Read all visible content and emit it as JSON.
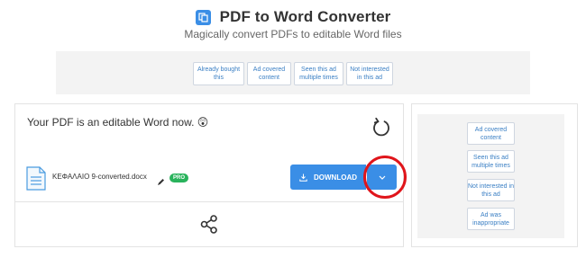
{
  "header": {
    "title": "PDF to Word Converter",
    "subtitle": "Magically convert PDFs to editable Word files",
    "icon": "document-convert-icon"
  },
  "top_ad_feedback": [
    "Already bought this",
    "Ad covered content",
    "Seen this ad multiple times",
    "Not interested in this ad"
  ],
  "result": {
    "status": "Your PDF is an editable Word now. 😲",
    "file_name": "ΚΕΦΑΛΑΙΟ 9-converted.docx",
    "pro_badge": "PRO",
    "download_label": "DOWNLOAD"
  },
  "side_ad_feedback": [
    "Ad covered content",
    "Seen this ad multiple times",
    "Not interested in this ad",
    "Ad was inappropriate"
  ],
  "colors": {
    "accent": "#3a8ee6",
    "pro": "#29b35c",
    "highlight": "#e0151b"
  }
}
